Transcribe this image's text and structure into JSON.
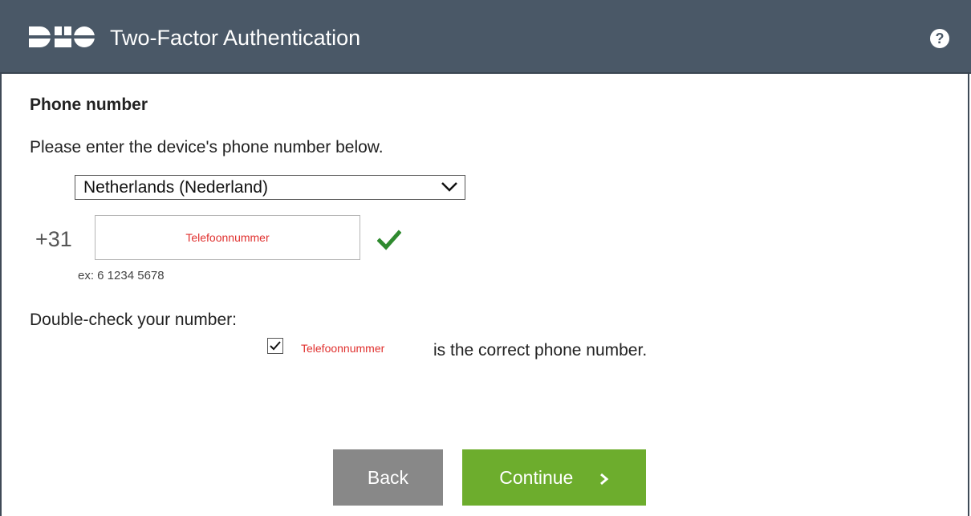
{
  "header": {
    "logo_text": "DUO",
    "title": "Two-Factor Authentication",
    "help_icon": "question-circle-icon",
    "background_color": "#4a5867"
  },
  "form": {
    "section_title": "Phone number",
    "instructions": "Please enter the device's phone number below.",
    "country_select": {
      "value": "Netherlands (Nederland)"
    },
    "country_code": "+31",
    "phone_input": {
      "value": "Telefoonnummer"
    },
    "valid_icon": "checkmark-icon",
    "example": "ex: 6 1234 5678",
    "double_check_label": "Double-check your number:",
    "confirm": {
      "checked": true,
      "phone_echo": "Telefoonnummer",
      "text": "is the correct phone number."
    }
  },
  "buttons": {
    "back_label": "Back",
    "continue_label": "Continue",
    "continue_color": "#6dad2d",
    "back_color": "#888888"
  }
}
